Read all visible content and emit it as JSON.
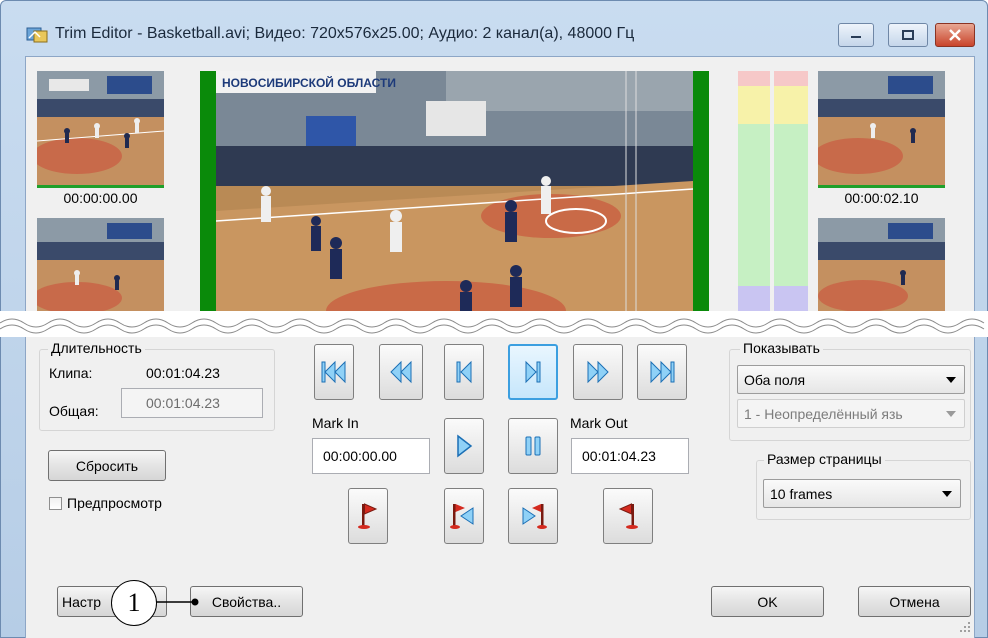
{
  "window": {
    "title": "Trim Editor - Basketball.avi; Видео: 720x576x25.00; Аудио: 2 канал(а), 48000 Гц"
  },
  "thumbnails": {
    "left_top_time": "00:00:00.00",
    "right_top_time": "00:00:02.10"
  },
  "preview": {
    "banner_text": "НОВОСИБИРСКОЙ ОБЛАСТИ"
  },
  "duration": {
    "group_label": "Длительность",
    "clip_label": "Клипа:",
    "clip_value": "00:01:04.23",
    "total_label": "Общая:",
    "total_value": "00:01:04.23"
  },
  "reset_button": "Сбросить",
  "preview_checkbox": {
    "label": "Предпросмотр",
    "checked": false
  },
  "marks": {
    "in_label": "Mark In",
    "in_value": "00:00:00.00",
    "out_label": "Mark Out",
    "out_value": "00:01:04.23"
  },
  "transport": {
    "icons": [
      "go-start-icon",
      "rewind-icon",
      "prev-frame-icon",
      "next-frame-icon",
      "fast-forward-icon",
      "go-end-icon",
      "play-icon",
      "pause-icon",
      "mark-in-flag-icon",
      "goto-mark-in-icon",
      "goto-mark-out-icon",
      "mark-out-flag-icon"
    ],
    "accent": "#2f8fd6",
    "flag_color": "#d42a1f"
  },
  "show": {
    "group_label": "Показывать",
    "fields_value": "Оба поля",
    "language_value": "1 - Неопределённый язь"
  },
  "page_size": {
    "group_label": "Размер страницы",
    "value": "10 frames"
  },
  "footer": {
    "settings_button": "Настр",
    "properties_button": "Свойства..",
    "ok_button": "OK",
    "cancel_button": "Отмена"
  },
  "callout": {
    "number": "1"
  }
}
